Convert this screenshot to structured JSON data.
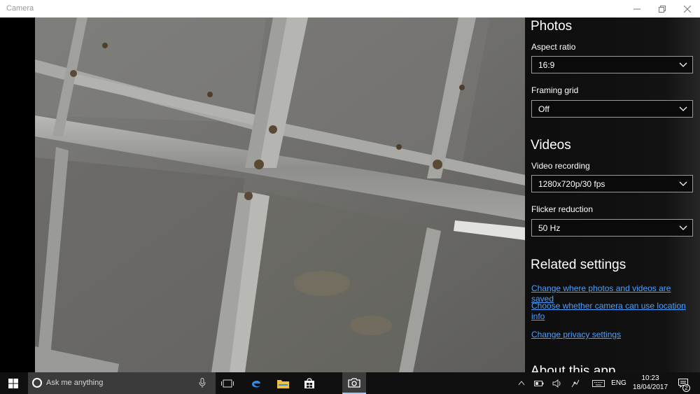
{
  "window": {
    "title": "Camera"
  },
  "settings": {
    "photos": {
      "heading": "Photos",
      "aspect_ratio_label": "Aspect ratio",
      "aspect_ratio_value": "16:9",
      "framing_grid_label": "Framing grid",
      "framing_grid_value": "Off"
    },
    "videos": {
      "heading": "Videos",
      "video_recording_label": "Video recording",
      "video_recording_value": "1280x720p/30 fps",
      "flicker_reduction_label": "Flicker reduction",
      "flicker_reduction_value": "50 Hz"
    },
    "related": {
      "heading": "Related settings",
      "link_save_location": "Change where photos and videos are saved",
      "link_location_info": "Choose whether camera can use location info",
      "link_privacy": "Change privacy settings"
    },
    "about": {
      "heading": "About this app"
    }
  },
  "taskbar": {
    "search_placeholder": "Ask me anything",
    "language": "ENG",
    "time": "10:23",
    "date": "18/04/2017",
    "notification_count": "2",
    "icons": [
      "windows-start-icon",
      "cortana-icon",
      "microphone-icon",
      "task-view-icon",
      "edge-icon",
      "file-explorer-icon",
      "store-icon",
      "camera-icon",
      "chevron-up-icon",
      "battery-icon",
      "volume-icon",
      "network-icon",
      "keyboard-icon",
      "action-center-icon"
    ]
  },
  "colors": {
    "link": "#4aa1ff",
    "taskbar": "#101010",
    "search_box": "#3b3b3b",
    "panel": "#141414"
  }
}
